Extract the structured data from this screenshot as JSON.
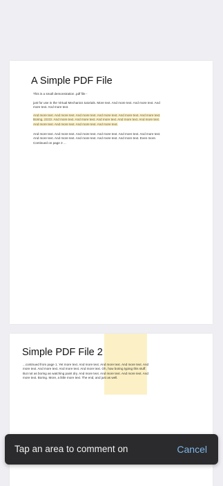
{
  "document": {
    "page1": {
      "title": "A Simple PDF File",
      "para1": "This is a small demonstration .pdf file -",
      "para2": "just for use in the Virtual Mechanics tutorials. More text. And more text. And more text. And more text. And more text.",
      "para3_highlighted": "And more text. And more text. And more text. And more text. And more text. And more text. Boring, zzzzz. And more text. And more text. And more text. And more text. And more text. And more text. And more text. And more text. And more text.",
      "para4": "And more text. And more text. And more text. And more text. And more text. And more text. And more text. And more text. And more text. And more text. And more text. Even more. Continued on page 2 ..."
    },
    "page2": {
      "title": "Simple PDF File 2",
      "para1": "...continued from page 1. Yet more text. And more text. And more text. And more text. And more text. And more text. And more text. And more text. Oh, how boring typing this stuff. But not as boring as watching paint dry. And more text. And more text. And more text. And more text. Boring. More, a little more text. The end, and just as well."
    }
  },
  "toast": {
    "message": "Tap an area to comment on",
    "cancel_label": "Cancel"
  },
  "colors": {
    "background": "#efeef3",
    "highlight": "#fbefc3",
    "toast_bg": "#2b2b2d",
    "accent": "#7fb6ea"
  }
}
